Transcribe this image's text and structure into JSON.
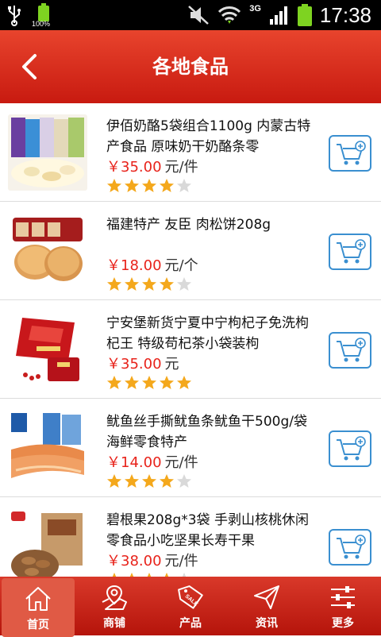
{
  "status_bar": {
    "battery_small_pct": "100%",
    "network": "3G",
    "time": "17:38"
  },
  "header": {
    "title": "各地食品"
  },
  "products": [
    {
      "title": "伊佰奶酪5袋组合1100g 内蒙古特产食品 原味奶干奶酪条零",
      "price": "￥35.00",
      "unit": "元/件",
      "rating": 4
    },
    {
      "title": "福建特产 友臣 肉松饼208g",
      "price": "￥18.00",
      "unit": "元/个",
      "rating": 4
    },
    {
      "title": "宁安堡新货宁夏中宁枸杞子免洗枸杞王 特级苟杞茶小袋装枸",
      "price": "￥35.00",
      "unit": "元",
      "rating": 5
    },
    {
      "title": "鱿鱼丝手撕鱿鱼条鱿鱼干500g/袋海鲜零食特产",
      "price": "￥14.00",
      "unit": "元/件",
      "rating": 4
    },
    {
      "title": "碧根果208g*3袋 手剥山核桃休闲零食品小吃坚果长寿干果",
      "price": "￥38.00",
      "unit": "元/件",
      "rating": 4
    }
  ],
  "tabs": [
    {
      "label": "首页",
      "icon": "home-icon"
    },
    {
      "label": "商铺",
      "icon": "map-store-icon"
    },
    {
      "label": "产品",
      "icon": "sale-tag-icon"
    },
    {
      "label": "资讯",
      "icon": "paper-plane-icon"
    },
    {
      "label": "更多",
      "icon": "sliders-icon"
    }
  ],
  "colors": {
    "header_red": "#d42a1c",
    "price_red": "#e8231b",
    "cart_blue": "#3a8fd0",
    "star_gold": "#f4a81c"
  }
}
